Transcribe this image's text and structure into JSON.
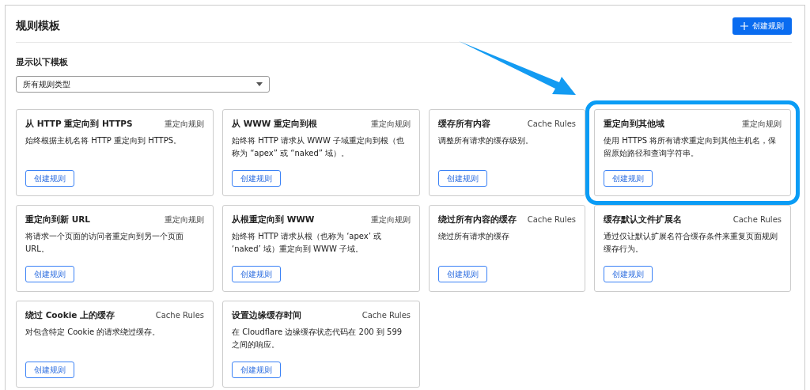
{
  "header": {
    "title": "规则模板",
    "create_button": "创建规则"
  },
  "filter": {
    "label": "显示以下模板",
    "value": "所有规则类型"
  },
  "cards": [
    {
      "title": "从 HTTP 重定向到 HTTPS",
      "tag": "重定向规则",
      "description": "始终根据主机名将 HTTP 重定向到 HTTPS。",
      "button": "创建规则",
      "highlighted": false
    },
    {
      "title": "从 WWW 重定向到根",
      "tag": "重定向规则",
      "description": "始终将 HTTP 请求从 WWW 子域重定向到根（也称为 “apex” 或 “naked” 域）。",
      "button": "创建规则",
      "highlighted": false
    },
    {
      "title": "缓存所有内容",
      "tag": "Cache Rules",
      "description": "调整所有请求的缓存级别。",
      "button": "创建规则",
      "highlighted": false
    },
    {
      "title": "重定向到其他域",
      "tag": "重定向规则",
      "description": "使用 HTTPS 将所有请求重定向到其他主机名，保留原始路径和查询字符串。",
      "button": "创建规则",
      "highlighted": true
    },
    {
      "title": "重定向到新 URL",
      "tag": "重定向规则",
      "description": "将请求一个页面的访问者重定向到另一个页面 URL。",
      "button": "创建规则",
      "highlighted": false
    },
    {
      "title": "从根重定向到 WWW",
      "tag": "重定向规则",
      "description": "始终将 HTTP 请求从根（也称为 ‘apex’ 或 ‘naked’ 域）重定向到 WWW 子域。",
      "button": "创建规则",
      "highlighted": false
    },
    {
      "title": "绕过所有内容的缓存",
      "tag": "Cache Rules",
      "description": "绕过所有请求的缓存",
      "button": "创建规则",
      "highlighted": false
    },
    {
      "title": "缓存默认文件扩展名",
      "tag": "Cache Rules",
      "description": "通过仅让默认扩展名符合缓存条件来重复页面规则缓存行为。",
      "button": "创建规则",
      "highlighted": false
    },
    {
      "title": "绕过 Cookie 上的缓存",
      "tag": "Cache Rules",
      "description": "对包含特定 Cookie 的请求绕过缓存。",
      "button": "创建规则",
      "highlighted": false
    },
    {
      "title": "设置边缘缓存时间",
      "tag": "Cache Rules",
      "description": "在 Cloudflare 边缘缓存状态代码在 200 到 599 之间的响应。",
      "button": "创建规则",
      "highlighted": false
    }
  ]
}
